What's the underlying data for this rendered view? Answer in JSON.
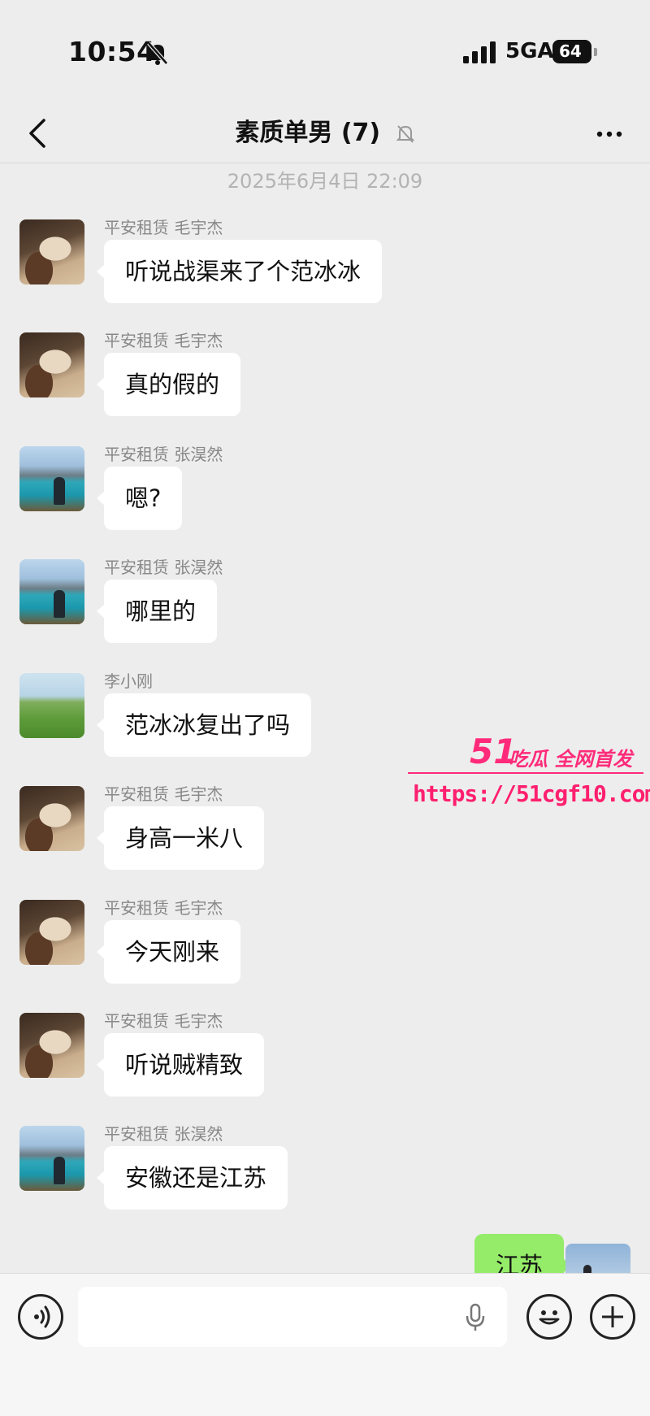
{
  "status_bar": {
    "time": "10:54",
    "network": "5GA",
    "battery": "64"
  },
  "nav": {
    "title": "素质单男 (7)"
  },
  "timestamp": "2025年6月4日 22:09",
  "messages": [
    {
      "sender": "平安租赁 毛宇杰",
      "text": "听说战渠来了个范冰冰",
      "avatar": "portrait"
    },
    {
      "sender": "平安租赁 毛宇杰",
      "text": "真的假的",
      "avatar": "portrait"
    },
    {
      "sender": "平安租赁 张淏然",
      "text": "嗯?",
      "avatar": "lake"
    },
    {
      "sender": "平安租赁 张淏然",
      "text": "哪里的",
      "avatar": "lake"
    },
    {
      "sender": "李小刚",
      "text": "范冰冰复出了吗",
      "avatar": "field"
    },
    {
      "sender": "平安租赁 毛宇杰",
      "text": "身高一米八",
      "avatar": "portrait"
    },
    {
      "sender": "平安租赁 毛宇杰",
      "text": "今天刚来",
      "avatar": "portrait"
    },
    {
      "sender": "平安租赁 毛宇杰",
      "text": "听说贼精致",
      "avatar": "portrait"
    },
    {
      "sender": "平安租赁 张淏然",
      "text": "安徽还是江苏",
      "avatar": "lake"
    }
  ],
  "my_message": {
    "text": "江苏"
  },
  "watermark": {
    "brand": "51",
    "slogan": "吃瓜 全网首发",
    "url": "https://51cgf10.com"
  },
  "colors": {
    "background": "#ededed",
    "my_bubble": "#95ec69",
    "watermark": "#ff2b7a"
  }
}
